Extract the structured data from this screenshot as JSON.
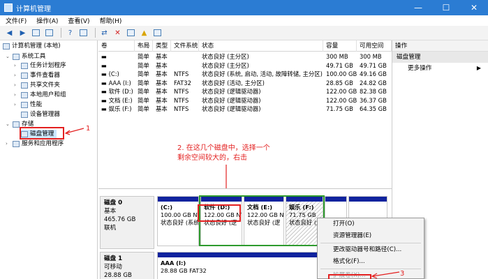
{
  "window": {
    "title": "计算机管理",
    "controls": [
      "—",
      "☐",
      "✕"
    ]
  },
  "menu": [
    "文件(F)",
    "操作(A)",
    "查看(V)",
    "帮助(H)"
  ],
  "toolbar_icons": [
    "back-arrow-icon",
    "forward-arrow-icon",
    "up-folder-icon",
    "show-tree-icon",
    "help-icon",
    "console-icon",
    "connect-icon",
    "delete-icon",
    "properties-icon",
    "refresh-icon",
    "export-icon"
  ],
  "tree": {
    "root": "计算机管理 (本地)",
    "system_tools": "系统工具",
    "task_scheduler": "任务计划程序",
    "event_viewer": "事件查看器",
    "shared_folders": "共享文件夹",
    "local_users": "本地用户和组",
    "performance": "性能",
    "device_manager": "设备管理器",
    "storage": "存储",
    "disk_management": "磁盘管理",
    "services_apps": "服务和应用程序"
  },
  "table": {
    "headers": [
      "卷",
      "布局",
      "类型",
      "文件系统",
      "状态",
      "容量",
      "可用空间"
    ],
    "rows": [
      [
        "▬",
        "简单",
        "基本",
        "",
        "状态良好 (主分区)",
        "300 MB",
        "300 MB"
      ],
      [
        "▬",
        "简单",
        "基本",
        "",
        "状态良好 (主分区)",
        "49.71 GB",
        "49.71 GB"
      ],
      [
        "▬ (C:)",
        "简单",
        "基本",
        "NTFS",
        "状态良好 (系统, 启动, 活动, 故障转储, 主分区)",
        "100.00 GB",
        "49.16 GB"
      ],
      [
        "▬ AAA (I:)",
        "简单",
        "基本",
        "FAT32",
        "状态良好 (活动, 主分区)",
        "28.85 GB",
        "24.82 GB"
      ],
      [
        "▬ 软件 (D:)",
        "简单",
        "基本",
        "NTFS",
        "状态良好 (逻辑驱动器)",
        "122.00 GB",
        "82.38 GB"
      ],
      [
        "▬ 文档 (E:)",
        "简单",
        "基本",
        "NTFS",
        "状态良好 (逻辑驱动器)",
        "122.00 GB",
        "36.37 GB"
      ],
      [
        "▬ 娱乐 (F:)",
        "简单",
        "基本",
        "NTFS",
        "状态良好 (逻辑驱动器)",
        "71.75 GB",
        "64.35 GB"
      ]
    ]
  },
  "annotations": {
    "one": "1",
    "two_line1": "2. 在这几个磁盘中，选择一个",
    "two_line2": "剩余空间较大的，右击",
    "three": "3"
  },
  "disk0": {
    "name": "磁盘 0",
    "type": "基本",
    "size": "465.76 GB",
    "status": "联机",
    "partitions": [
      {
        "name": "(C:)",
        "size": "100.00 GB NTFS",
        "status": "状态良好 (系统"
      },
      {
        "name": "软件  (D:)",
        "size": "122.00 GB NT",
        "status": "状态良好 (逻"
      },
      {
        "name": "文档  (E:)",
        "size": "122.00 GB NT",
        "status": "状态良好 (逻"
      },
      {
        "name": "娱乐  (F:)",
        "size": "71.75 GB",
        "status": "状态良好 (逻"
      },
      {
        "name": "",
        "size": "",
        "status": ""
      },
      {
        "name": "",
        "size": "",
        "status": ""
      }
    ]
  },
  "disk1": {
    "name": "磁盘 1",
    "type": "可移动",
    "size": "28.88 GB",
    "partitions": [
      {
        "name": "AAA  (I:)",
        "size": "28.88 GB FAT32"
      }
    ]
  },
  "actions": {
    "header": "操作",
    "selected": "磁盘管理",
    "more": "更多操作"
  },
  "context_menu": [
    "打开(O)",
    "资源管理器(E)",
    "更改驱动器号和路径(C)...",
    "格式化(F)...",
    "扩展卷(X)..."
  ],
  "colors": {
    "title_bar": "#2b7cd3",
    "partition_bar": "#10239e",
    "annotation_red": "#e32020",
    "highlight_green": "#2e9b2e"
  }
}
